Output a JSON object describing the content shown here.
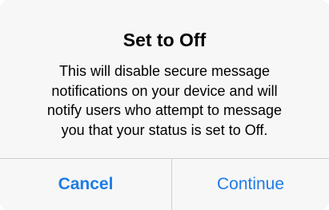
{
  "alert": {
    "title": "Set to Off",
    "message_lines": [
      "This will disable secure message",
      "notifications on your device and will",
      "notify users who attempt to message",
      "you that your status is set to Off."
    ],
    "buttons": {
      "cancel": "Cancel",
      "continue": "Continue"
    }
  },
  "colors": {
    "button_text": "#1f7ce6",
    "background": "#f7f7f7",
    "separator": "#cfcfd3"
  }
}
